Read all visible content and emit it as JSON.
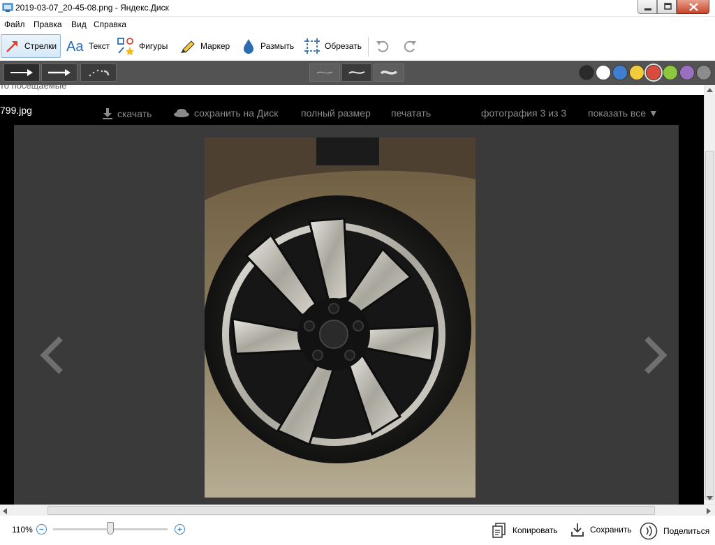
{
  "window": {
    "title": "2019-03-07_20-45-08.png - Яндекс.Диск"
  },
  "menu": [
    "Файл",
    "Правка",
    "Вид",
    "Справка"
  ],
  "tools": {
    "arrows": "Стрелки",
    "text": "Текст",
    "shapes": "Фигуры",
    "marker": "Маркер",
    "blur": "Размыть",
    "crop": "Обрезать"
  },
  "colors": [
    "#2b2b2b",
    "#ffffff",
    "#3f7fcf",
    "#f2cb3a",
    "#d94b3c",
    "#8dc63f",
    "#9a6fc0",
    "#8c8c8c"
  ],
  "selected_color": "#d94b3c",
  "viewer": {
    "background_text": "то посещаемые",
    "filename": "799.jpg",
    "download": "скачать",
    "save_to_disk": "сохранить на Диск",
    "full_size": "полный размер",
    "print": "печатать",
    "counter": "фотография 3 из 3",
    "show_all": "показать все ▼"
  },
  "status": {
    "zoom": "110%",
    "zoom_level": 0.5,
    "copy": "Копировать",
    "save": "Сохранить",
    "share": "Поделиться"
  }
}
